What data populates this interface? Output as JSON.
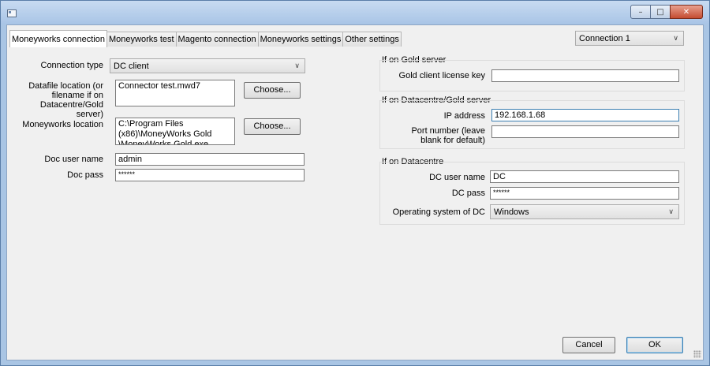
{
  "window": {
    "icon": "app-icon",
    "controls": {
      "minimize_icon": "minimize-icon",
      "maximize_icon": "maximize-icon",
      "close_icon": "close-icon"
    }
  },
  "tabs": [
    {
      "label": "Moneyworks connection",
      "active": true
    },
    {
      "label": "Moneyworks test"
    },
    {
      "label": "Magento connection"
    },
    {
      "label": "Moneyworks settings"
    },
    {
      "label": "Other settings"
    }
  ],
  "connection_select": {
    "value": "Connection 1"
  },
  "left": {
    "connection_type": {
      "label": "Connection type",
      "value": "DC client"
    },
    "datafile": {
      "label_lines": [
        "Datafile location (or",
        "filename if on",
        "Datacentre/Gold server)"
      ],
      "value": "Connector test.mwd7",
      "button": "Choose..."
    },
    "mw_location": {
      "label": "Moneyworks location",
      "value": "C:\\Program Files\n(x86)\\MoneyWorks Gold\n\\MoneyWorks Gold.exe",
      "button": "Choose..."
    },
    "doc_user": {
      "label": "Doc user name",
      "value": "admin"
    },
    "doc_pass": {
      "label": "Doc pass",
      "value": "******"
    }
  },
  "gold_server": {
    "title": "If on Gold server",
    "license": {
      "label": "Gold client license key",
      "value": ""
    }
  },
  "datacentre_gold": {
    "title": "If on Datacentre/Gold server",
    "ip": {
      "label": "IP address",
      "value": "192.168.1.68"
    },
    "port": {
      "label_lines": [
        "Port number (leave",
        "blank for default)"
      ],
      "value": ""
    }
  },
  "datacentre": {
    "title": "If on Datacentre",
    "dc_user": {
      "label": "DC user name",
      "value": "DC"
    },
    "dc_pass": {
      "label": "DC pass",
      "value": "******"
    },
    "os": {
      "label": "Operating system of DC",
      "value": "Windows"
    }
  },
  "footer": {
    "cancel": "Cancel",
    "ok": "OK"
  }
}
